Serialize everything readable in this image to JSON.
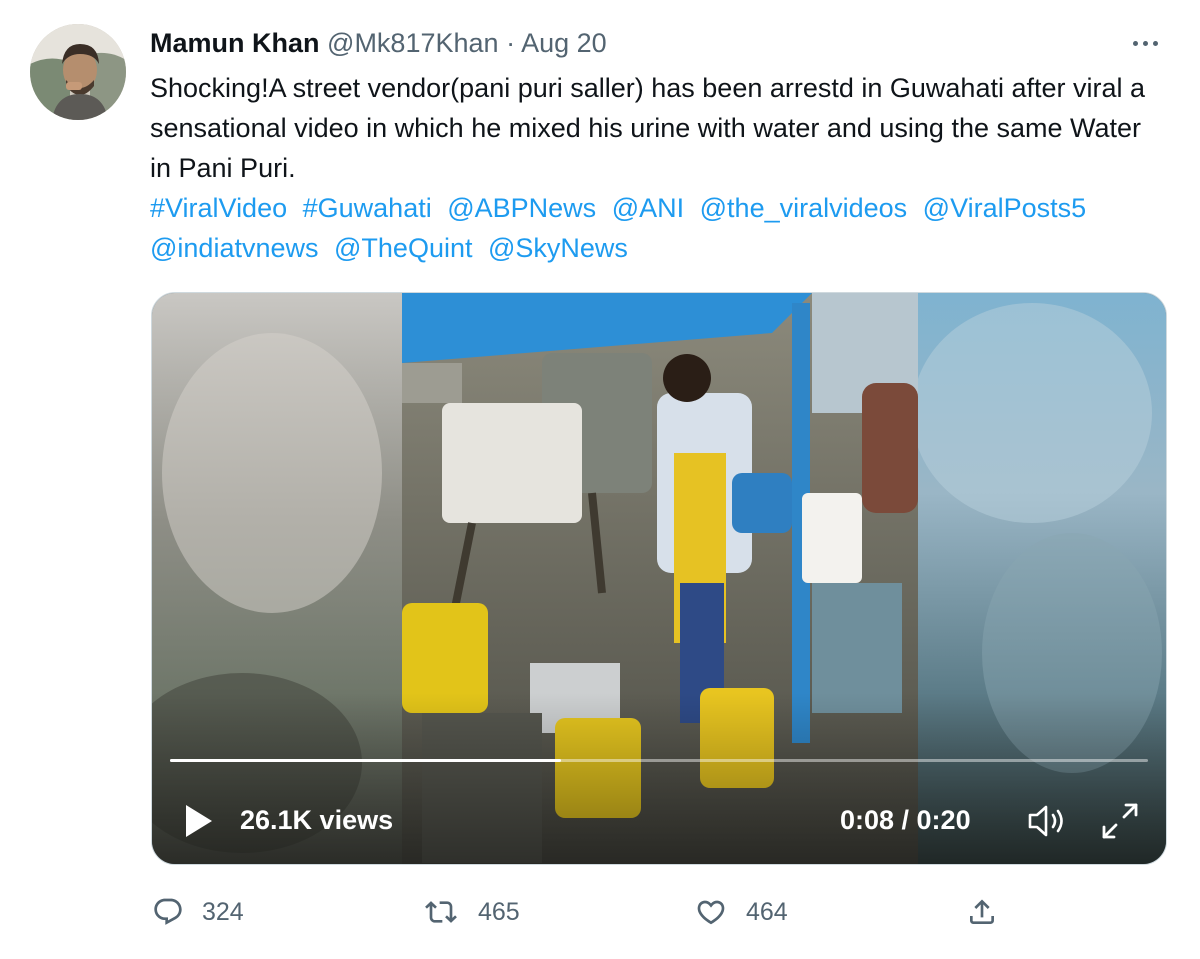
{
  "author": {
    "name": "Mamun Khan",
    "handle": "@Mk817Khan",
    "separator": "·",
    "date": "Aug 20"
  },
  "tweet": {
    "text": "Shocking!A street vendor(pani puri saller) has been arrestd in Guwahati after viral a sensational video in which he mixed his urine with water and using the same Water in Pani Puri.",
    "tags": [
      "#ViralVideo",
      "#Guwahati",
      "@ABPNews",
      "@ANI",
      "@the_viralvideos",
      "@ViralPosts5",
      "@indiatvnews",
      "@TheQuint",
      "@SkyNews"
    ]
  },
  "video": {
    "views": "26.1K views",
    "time": "0:08 / 0:20",
    "progress": 0.4
  },
  "actions": {
    "replies": "324",
    "retweets": "465",
    "likes": "464"
  },
  "colors": {
    "link": "#1d9bf0",
    "secondary_text": "#536471",
    "primary_text": "#0f1419"
  },
  "icons": [
    "more-icon",
    "play-icon",
    "volume-icon",
    "fullscreen-icon",
    "reply-icon",
    "retweet-icon",
    "like-icon",
    "share-icon"
  ]
}
